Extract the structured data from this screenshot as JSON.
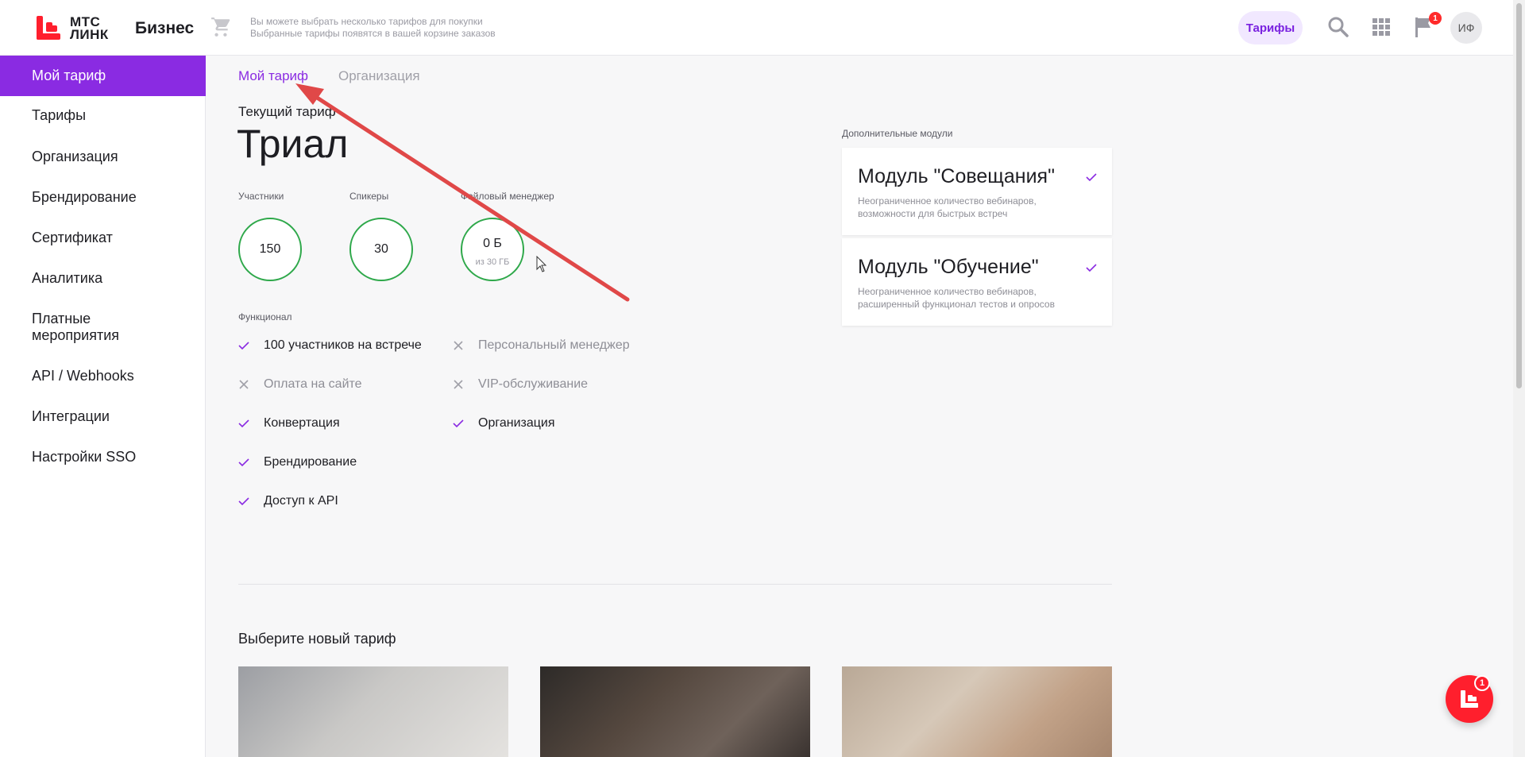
{
  "header": {
    "logo_text_line1": "МТС",
    "logo_text_line2": "ЛИНК",
    "brand": "Бизнес",
    "cart_hint_line1": "Вы можете выбрать несколько тарифов для покупки",
    "cart_hint_line2": "Выбранные тарифы появятся в вашей корзине заказов",
    "tariffs_button": "Тарифы",
    "notifications_count": "1",
    "avatar_initials": "ИФ",
    "icons": [
      "cart-icon",
      "search-icon",
      "apps-grid-icon",
      "flag-icon"
    ]
  },
  "sidebar": {
    "items": [
      {
        "label": "Мой тариф",
        "active": true
      },
      {
        "label": "Тарифы"
      },
      {
        "label": "Организация"
      },
      {
        "label": "Брендирование"
      },
      {
        "label": "Сертификат"
      },
      {
        "label": "Аналитика"
      },
      {
        "label": "Платные мероприятия"
      },
      {
        "label": "API / Webhooks"
      },
      {
        "label": "Интеграции"
      },
      {
        "label": "Настройки SSO"
      }
    ]
  },
  "tabs": [
    {
      "label": "Мой тариф",
      "active": true
    },
    {
      "label": "Организация"
    }
  ],
  "plan": {
    "current_label": "Текущий тариф",
    "name": "Триал",
    "stats": [
      {
        "label": "Участники",
        "value": "150"
      },
      {
        "label": "Спикеры",
        "value": "30"
      },
      {
        "label": "Файловый менеджер",
        "value": "0 Б",
        "sub": "из 30 ГБ"
      }
    ]
  },
  "features": {
    "label": "Функционал",
    "items": [
      {
        "label": "100 участников на встрече",
        "enabled": true
      },
      {
        "label": "Персональный менеджер",
        "enabled": false
      },
      {
        "label": "Оплата на сайте",
        "enabled": false
      },
      {
        "label": "VIP-обслуживание",
        "enabled": false
      },
      {
        "label": "Конвертация",
        "enabled": true
      },
      {
        "label": "Организация",
        "enabled": true
      },
      {
        "label": "Брендирование",
        "enabled": true
      },
      {
        "label": "Доступ к API",
        "enabled": true
      }
    ]
  },
  "modules": {
    "title": "Дополнительные модули",
    "items": [
      {
        "name": "Модуль \"Совещания\"",
        "desc_line1": "Неограниченное количество вебинаров,",
        "desc_line2": "возможности для быстрых встреч"
      },
      {
        "name": "Модуль \"Обучение\"",
        "desc_line1": "Неограниченное количество вебинаров,",
        "desc_line2": "расширенный функционал тестов и опросов"
      }
    ]
  },
  "choose": {
    "title": "Выберите новый тариф"
  },
  "chat": {
    "badge": "1"
  },
  "colors": {
    "accent": "#8a2be2",
    "brand_red": "#ff1f2d",
    "success": "#2ea84a"
  }
}
